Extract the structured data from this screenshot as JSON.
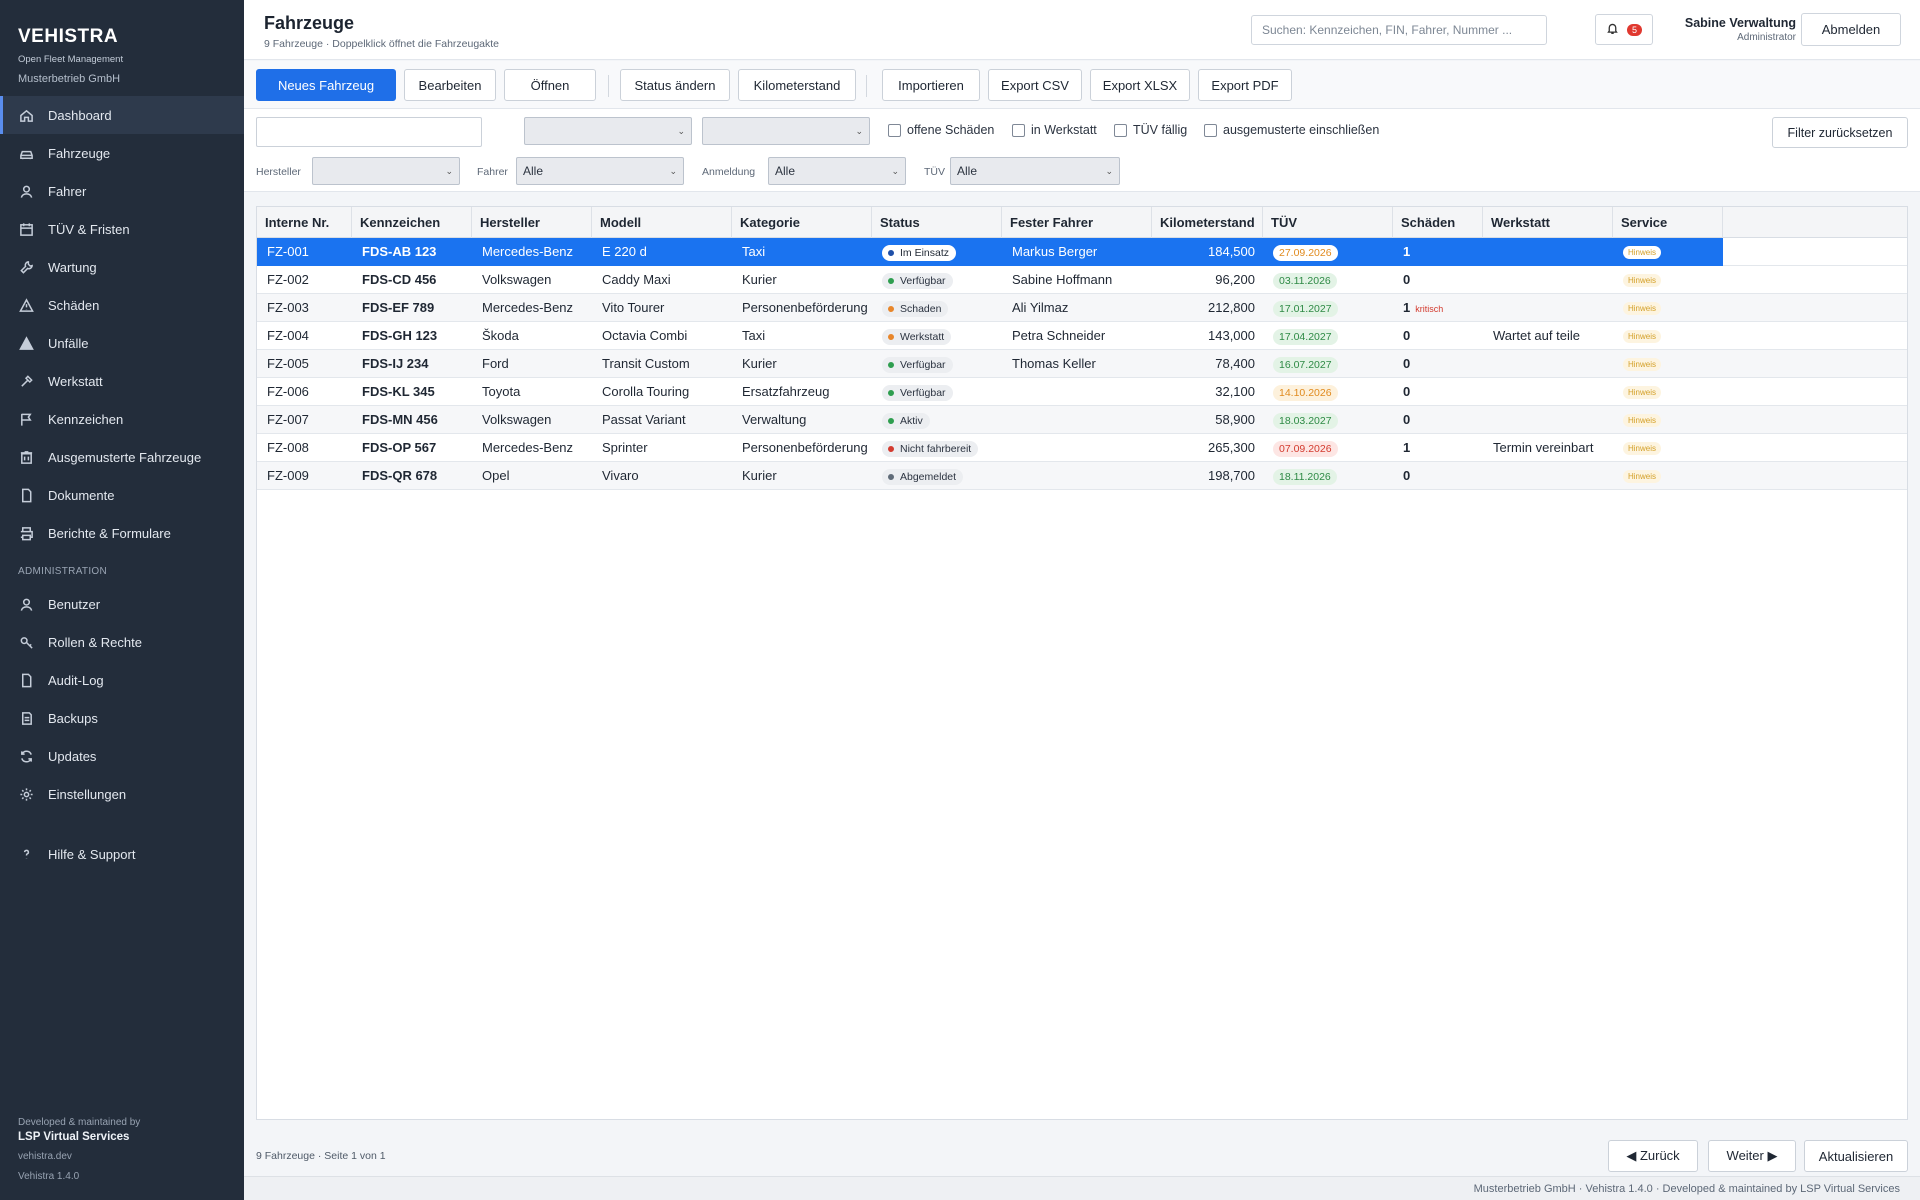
{
  "brand": {
    "name": "VEHISTRA",
    "subtitle": "Open Fleet Management",
    "company": "Musterbetrieb GmbH"
  },
  "sidebar": {
    "items": [
      {
        "label": "Dashboard",
        "icon": "home-icon",
        "active": true
      },
      {
        "label": "Fahrzeuge",
        "icon": "car-icon"
      },
      {
        "label": "Fahrer",
        "icon": "user-icon"
      },
      {
        "label": "TÜV & Fristen",
        "icon": "calendar-icon"
      },
      {
        "label": "Wartung",
        "icon": "wrench-icon"
      },
      {
        "label": "Schäden",
        "icon": "warning-icon"
      },
      {
        "label": "Unfälle",
        "icon": "alert-triangle-icon"
      },
      {
        "label": "Werkstatt",
        "icon": "tool-icon"
      },
      {
        "label": "Kennzeichen",
        "icon": "flag-icon"
      },
      {
        "label": "Ausgemusterte Fahrzeuge",
        "icon": "archive-icon"
      },
      {
        "label": "Dokumente",
        "icon": "document-icon"
      },
      {
        "label": "Berichte & Formulare",
        "icon": "printer-icon"
      }
    ],
    "admin_section": "ADMINISTRATION",
    "admin_items": [
      {
        "label": "Benutzer",
        "icon": "user-icon"
      },
      {
        "label": "Rollen & Rechte",
        "icon": "key-icon"
      },
      {
        "label": "Audit-Log",
        "icon": "document-icon"
      },
      {
        "label": "Backups",
        "icon": "backup-icon"
      },
      {
        "label": "Updates",
        "icon": "refresh-icon"
      },
      {
        "label": "Einstellungen",
        "icon": "gear-icon"
      }
    ],
    "help": {
      "label": "Hilfe & Support",
      "icon": "help-icon"
    },
    "footer": {
      "developed": "Developed & maintained by",
      "company": "LSP Virtual Services",
      "website": "vehistra.dev",
      "version": "Vehistra 1.4.0"
    }
  },
  "header": {
    "title": "Fahrzeuge",
    "subtitle": "9 Fahrzeuge · Doppelklick öffnet die Fahrzeugakte",
    "search_placeholder": "Suchen: Kennzeichen, FIN, Fahrer, Nummer ...",
    "notification_count": "5",
    "user_name": "Sabine Verwaltung",
    "user_role": "Administrator",
    "logout_label": "Abmelden"
  },
  "toolbar": {
    "new_vehicle": "Neues Fahrzeug",
    "edit": "Bearbeiten",
    "open": "Öffnen",
    "change_status": "Status ändern",
    "mileage": "Kilometerstand",
    "import": "Importieren",
    "export_csv": "Export CSV",
    "export_xlsx": "Export XLSX",
    "export_pdf": "Export PDF"
  },
  "filters": {
    "search_value": "",
    "select1_value": "",
    "select2_value": "",
    "check_damages": "offene Schäden",
    "check_workshop": "in Werkstatt",
    "check_tuev": "TÜV fällig",
    "check_retired": "ausgemusterte einschließen",
    "reset": "Filter zurücksetzen",
    "manufacturer_label": "Hersteller",
    "manufacturer_value": "",
    "driver_label": "Fahrer",
    "driver_value": "Alle",
    "registration_label": "Anmeldung",
    "registration_value": "Alle",
    "tuev_label": "TÜV",
    "tuev_value": "Alle"
  },
  "table": {
    "columns": [
      "Interne Nr.",
      "Kennzeichen",
      "Hersteller",
      "Modell",
      "Kategorie",
      "Status",
      "Fester Fahrer",
      "Kilometerstand",
      "TÜV",
      "Schäden",
      "Werkstatt",
      "Service"
    ],
    "rows": [
      {
        "nr": "FZ-001",
        "plate": "FDS-AB 123",
        "maker": "Mercedes-Benz",
        "model": "E 220 d",
        "category": "Taxi",
        "status": "Im Einsatz",
        "status_color": "#1f4fa8",
        "driver": "Markus Berger",
        "km": "184,500",
        "tuev": "27.09.2026",
        "tuev_kind": "warn",
        "damages": "1",
        "damage_note": "",
        "workshop": "",
        "service": "Hinweis",
        "selected": true
      },
      {
        "nr": "FZ-002",
        "plate": "FDS-CD 456",
        "maker": "Volkswagen",
        "model": "Caddy Maxi",
        "category": "Kurier",
        "status": "Verfügbar",
        "status_color": "#2e9e4f",
        "driver": "Sabine Hoffmann",
        "km": "96,200",
        "tuev": "03.11.2026",
        "tuev_kind": "ok",
        "damages": "0",
        "damage_note": "",
        "workshop": "",
        "service": "Hinweis"
      },
      {
        "nr": "FZ-003",
        "plate": "FDS-EF 789",
        "maker": "Mercedes-Benz",
        "model": "Vito Tourer",
        "category": "Personenbeförderung",
        "status": "Schaden",
        "status_color": "#e8862a",
        "driver": "Ali Yilmaz",
        "km": "212,800",
        "tuev": "17.01.2027",
        "tuev_kind": "ok",
        "damages": "1",
        "damage_note": "kritisch",
        "workshop": "",
        "service": "Hinweis"
      },
      {
        "nr": "FZ-004",
        "plate": "FDS-GH 123",
        "maker": "Škoda",
        "model": "Octavia Combi",
        "category": "Taxi",
        "status": "Werkstatt",
        "status_color": "#e8862a",
        "driver": "Petra Schneider",
        "km": "143,000",
        "tuev": "17.04.2027",
        "tuev_kind": "ok",
        "damages": "0",
        "damage_note": "",
        "workshop": "Wartet auf teile",
        "service": "Hinweis"
      },
      {
        "nr": "FZ-005",
        "plate": "FDS-IJ 234",
        "maker": "Ford",
        "model": "Transit Custom",
        "category": "Kurier",
        "status": "Verfügbar",
        "status_color": "#2e9e4f",
        "driver": "Thomas Keller",
        "km": "78,400",
        "tuev": "16.07.2027",
        "tuev_kind": "ok",
        "damages": "0",
        "damage_note": "",
        "workshop": "",
        "service": "Hinweis"
      },
      {
        "nr": "FZ-006",
        "plate": "FDS-KL 345",
        "maker": "Toyota",
        "model": "Corolla Touring",
        "category": "Ersatzfahrzeug",
        "status": "Verfügbar",
        "status_color": "#2e9e4f",
        "driver": "",
        "km": "32,100",
        "tuev": "14.10.2026",
        "tuev_kind": "warn",
        "damages": "0",
        "damage_note": "",
        "workshop": "",
        "service": "Hinweis"
      },
      {
        "nr": "FZ-007",
        "plate": "FDS-MN 456",
        "maker": "Volkswagen",
        "model": "Passat Variant",
        "category": "Verwaltung",
        "status": "Aktiv",
        "status_color": "#2e9e4f",
        "driver": "",
        "km": "58,900",
        "tuev": "18.03.2027",
        "tuev_kind": "ok",
        "damages": "0",
        "damage_note": "",
        "workshop": "",
        "service": "Hinweis"
      },
      {
        "nr": "FZ-008",
        "plate": "FDS-OP 567",
        "maker": "Mercedes-Benz",
        "model": "Sprinter",
        "category": "Personenbeförderung",
        "status": "Nicht fahrbereit",
        "status_color": "#d33b2f",
        "driver": "",
        "km": "265,300",
        "tuev": "07.09.2026",
        "tuev_kind": "bad",
        "damages": "1",
        "damage_note": "",
        "workshop": "Termin vereinbart",
        "service": "Hinweis"
      },
      {
        "nr": "FZ-009",
        "plate": "FDS-QR 678",
        "maker": "Opel",
        "model": "Vivaro",
        "category": "Kurier",
        "status": "Abgemeldet",
        "status_color": "#5f6b78",
        "driver": "",
        "km": "198,700",
        "tuev": "18.11.2026",
        "tuev_kind": "ok",
        "damages": "0",
        "damage_note": "",
        "workshop": "",
        "service": "Hinweis"
      }
    ]
  },
  "footer": {
    "count_text": "9 Fahrzeuge · Seite 1 von 1",
    "back": "◀ Zurück",
    "next": "Weiter ▶",
    "refresh": "Aktualisieren",
    "status_line": "Musterbetrieb GmbH · Vehistra 1.4.0 · Developed & maintained by LSP Virtual Services"
  },
  "colors": {
    "primary": "#1f6fe8",
    "selected_row": "#1a73f0",
    "sidebar_bg": "#232d3b",
    "tuev_ok_bg": "#e3f3e6",
    "tuev_ok_fg": "#2e8a45",
    "tuev_warn_bg": "#fdf1dc",
    "tuev_warn_fg": "#e08a1e",
    "tuev_bad_bg": "#fde6e4",
    "tuev_bad_fg": "#d33b2f"
  }
}
